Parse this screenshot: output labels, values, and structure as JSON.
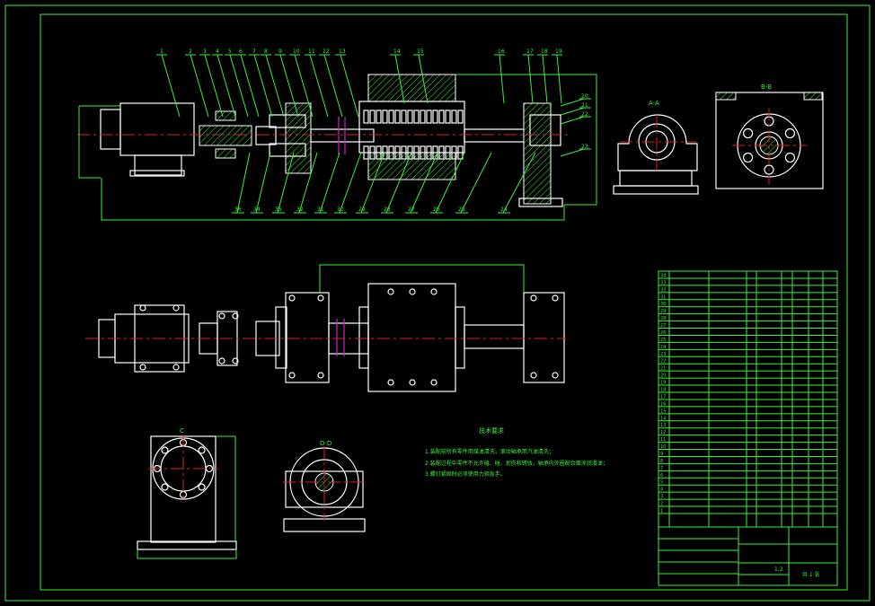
{
  "drawing": {
    "views": {
      "section_a": "A-A",
      "section_b": "B-B",
      "view_c": "C",
      "section_d": "D-D",
      "marker_a": "A",
      "marker_b": "B"
    },
    "part_numbers_top": [
      "1",
      "2",
      "3",
      "4",
      "5",
      "6",
      "7",
      "8",
      "9",
      "10",
      "11",
      "12",
      "13",
      "14",
      "15",
      "16",
      "17",
      "18",
      "19"
    ],
    "part_numbers_right": [
      "20",
      "21",
      "22",
      "23"
    ],
    "part_numbers_bottom": [
      "36",
      "34",
      "35",
      "32",
      "31",
      "30",
      "29",
      "28",
      "27",
      "26",
      "25",
      "24"
    ],
    "technical_requirements": {
      "heading": "技术要求",
      "lines": [
        "1.装配前所有零件用煤油清洗，滚动轴承用汽油清洗；",
        "2.装配过程中零件不允许磕、碰、划伤和锈蚀，轴承内外圈配合面涂润滑油；",
        "3.螺钉紧固时必须使用力矩扳手。"
      ]
    },
    "bom_item_numbers": [
      "34",
      "33",
      "32",
      "31",
      "30",
      "29",
      "28",
      "27",
      "26",
      "25",
      "24",
      "23",
      "22",
      "21",
      "20",
      "19",
      "18",
      "17",
      "16",
      "15",
      "14",
      "13",
      "12",
      "11",
      "10",
      "9",
      "8",
      "7",
      "6",
      "5",
      "4",
      "3",
      "2",
      "1"
    ],
    "title_block": {
      "scale": "1:2",
      "sheet": "共 1 张"
    },
    "colors": {
      "background": "#000000",
      "frame": "#3cf03c",
      "outline": "#ffffff",
      "centerline": "#e02020",
      "cut": "#d020d0"
    }
  }
}
